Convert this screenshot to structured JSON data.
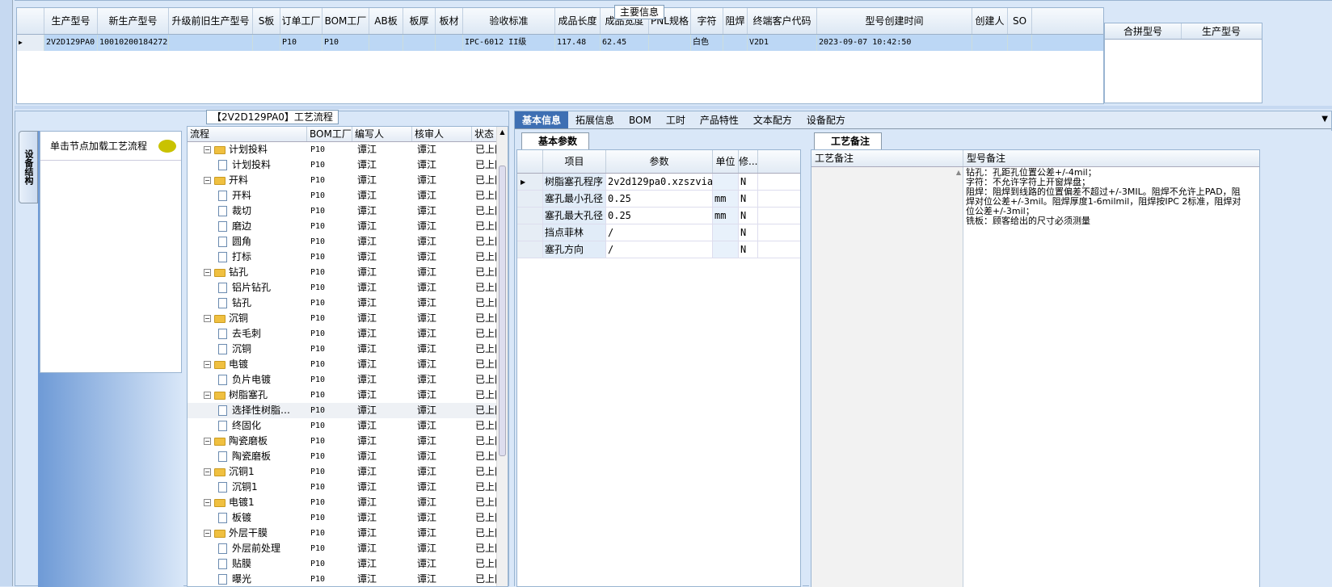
{
  "main_info": {
    "title": "主要信息",
    "columns": [
      "生产型号",
      "新生产型号",
      "升级前旧生产型号",
      "S板",
      "订单工厂",
      "BOM工厂",
      "AB板",
      "板厚",
      "板材",
      "验收标准",
      "成品长度",
      "成品宽度",
      "PNL规格",
      "字符",
      "阻焊",
      "终端客户代码",
      "型号创建时间",
      "创建人",
      "SO"
    ],
    "row": [
      "2V2D129PA0",
      "10010200184272",
      "",
      "",
      "P10",
      "P10",
      "",
      "",
      "",
      "IPC-6012 II级",
      "117.48",
      "62.45",
      "",
      "白色",
      "",
      "V2D1",
      "2023-09-07 10:42:50",
      "",
      ""
    ],
    "merge_columns": [
      "合拼型号",
      "生产型号"
    ]
  },
  "flow": {
    "title": "【2V2D129PA0】工艺流程",
    "side_tab": "设备结构",
    "node_hint": "单击节点加载工艺流程",
    "columns": [
      "流程",
      "BOM工厂",
      "编写人",
      "核审人",
      "状态"
    ],
    "rows": [
      {
        "level": 0,
        "name": "计划投料",
        "bom": "P10",
        "writer": "谭江",
        "reviewer": "谭江",
        "status": "已上网"
      },
      {
        "level": 1,
        "name": "计划投料",
        "bom": "P10",
        "writer": "谭江",
        "reviewer": "谭江",
        "status": "已上网"
      },
      {
        "level": 0,
        "name": "开料",
        "bom": "P10",
        "writer": "谭江",
        "reviewer": "谭江",
        "status": "已上网"
      },
      {
        "level": 1,
        "name": "开料",
        "bom": "P10",
        "writer": "谭江",
        "reviewer": "谭江",
        "status": "已上网"
      },
      {
        "level": 1,
        "name": "裁切",
        "bom": "P10",
        "writer": "谭江",
        "reviewer": "谭江",
        "status": "已上网"
      },
      {
        "level": 1,
        "name": "磨边",
        "bom": "P10",
        "writer": "谭江",
        "reviewer": "谭江",
        "status": "已上网"
      },
      {
        "level": 1,
        "name": "圆角",
        "bom": "P10",
        "writer": "谭江",
        "reviewer": "谭江",
        "status": "已上网"
      },
      {
        "level": 1,
        "name": "打标",
        "bom": "P10",
        "writer": "谭江",
        "reviewer": "谭江",
        "status": "已上网"
      },
      {
        "level": 0,
        "name": "钻孔",
        "bom": "P10",
        "writer": "谭江",
        "reviewer": "谭江",
        "status": "已上网"
      },
      {
        "level": 1,
        "name": "铝片钻孔",
        "bom": "P10",
        "writer": "谭江",
        "reviewer": "谭江",
        "status": "已上网"
      },
      {
        "level": 1,
        "name": "钻孔",
        "bom": "P10",
        "writer": "谭江",
        "reviewer": "谭江",
        "status": "已上网"
      },
      {
        "level": 0,
        "name": "沉铜",
        "bom": "P10",
        "writer": "谭江",
        "reviewer": "谭江",
        "status": "已上网"
      },
      {
        "level": 1,
        "name": "去毛刺",
        "bom": "P10",
        "writer": "谭江",
        "reviewer": "谭江",
        "status": "已上网"
      },
      {
        "level": 1,
        "name": "沉铜",
        "bom": "P10",
        "writer": "谭江",
        "reviewer": "谭江",
        "status": "已上网"
      },
      {
        "level": 0,
        "name": "电镀",
        "bom": "P10",
        "writer": "谭江",
        "reviewer": "谭江",
        "status": "已上网"
      },
      {
        "level": 1,
        "name": "负片电镀",
        "bom": "P10",
        "writer": "谭江",
        "reviewer": "谭江",
        "status": "已上网"
      },
      {
        "level": 0,
        "name": "树脂塞孔",
        "bom": "P10",
        "writer": "谭江",
        "reviewer": "谭江",
        "status": "已上网"
      },
      {
        "level": 1,
        "name": "选择性树脂…",
        "bom": "P10",
        "writer": "谭江",
        "reviewer": "谭江",
        "status": "已上网",
        "selected": true
      },
      {
        "level": 1,
        "name": "终固化",
        "bom": "P10",
        "writer": "谭江",
        "reviewer": "谭江",
        "status": "已上网"
      },
      {
        "level": 0,
        "name": "陶瓷磨板",
        "bom": "P10",
        "writer": "谭江",
        "reviewer": "谭江",
        "status": "已上网"
      },
      {
        "level": 1,
        "name": "陶瓷磨板",
        "bom": "P10",
        "writer": "谭江",
        "reviewer": "谭江",
        "status": "已上网"
      },
      {
        "level": 0,
        "name": "沉铜1",
        "bom": "P10",
        "writer": "谭江",
        "reviewer": "谭江",
        "status": "已上网"
      },
      {
        "level": 1,
        "name": "沉铜1",
        "bom": "P10",
        "writer": "谭江",
        "reviewer": "谭江",
        "status": "已上网"
      },
      {
        "level": 0,
        "name": "电镀1",
        "bom": "P10",
        "writer": "谭江",
        "reviewer": "谭江",
        "status": "已上网"
      },
      {
        "level": 1,
        "name": "板镀",
        "bom": "P10",
        "writer": "谭江",
        "reviewer": "谭江",
        "status": "已上网"
      },
      {
        "level": 0,
        "name": "外层干膜",
        "bom": "P10",
        "writer": "谭江",
        "reviewer": "谭江",
        "status": "已上网"
      },
      {
        "level": 1,
        "name": "外层前处理",
        "bom": "P10",
        "writer": "谭江",
        "reviewer": "谭江",
        "status": "已上网"
      },
      {
        "level": 1,
        "name": "贴膜",
        "bom": "P10",
        "writer": "谭江",
        "reviewer": "谭江",
        "status": "已上网"
      },
      {
        "level": 1,
        "name": "曝光",
        "bom": "P10",
        "writer": "谭江",
        "reviewer": "谭江",
        "status": "已上网"
      }
    ]
  },
  "detail_tabs": [
    "基本信息",
    "拓展信息",
    "BOM",
    "工时",
    "产品特性",
    "文本配方",
    "设备配方"
  ],
  "basic_params": {
    "tab": "基本参数",
    "columns": [
      "项目",
      "参数",
      "单位",
      "修..."
    ],
    "rows": [
      {
        "item": "树脂塞孔程序",
        "param": "2v2d129pa0.xzszvia",
        "unit": "",
        "mod": "N"
      },
      {
        "item": "塞孔最小孔径",
        "param": "0.25",
        "unit": "mm",
        "mod": "N"
      },
      {
        "item": "塞孔最大孔径",
        "param": "0.25",
        "unit": "mm",
        "mod": "N"
      },
      {
        "item": "挡点菲林",
        "param": "/",
        "unit": "",
        "mod": "N"
      },
      {
        "item": "塞孔方向",
        "param": "/",
        "unit": "",
        "mod": "N"
      }
    ]
  },
  "process_notes": {
    "tab": "工艺备注",
    "col1": "工艺备注",
    "col2": "型号备注",
    "lines": [
      "钻孔：孔距孔位置公差+/-4mil；",
      "字符：不允许字符上开窗焊盘；",
      "阻焊：阻焊到线路的位置偏差不超过+/-3MIL。阻焊不允许上PAD，阻焊对位公差+/-3mil。阻焊厚度1-6milmil，阻焊按IPC 2标准，阻焊对位公差+/-3mil；",
      "铣板：顾客给出的尺寸必须测量"
    ]
  },
  "colors": {
    "selected_row": "#bcd7f5",
    "tab_active": "#3e6fb3",
    "panel_bg": "#d9e7f8"
  }
}
